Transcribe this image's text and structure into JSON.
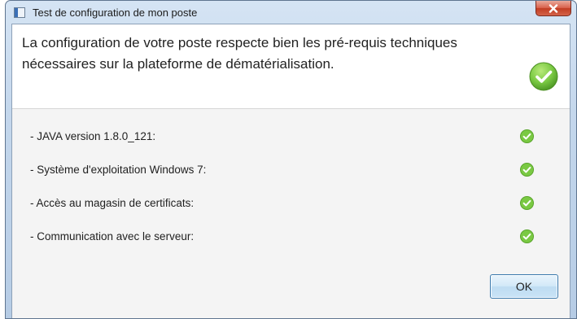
{
  "window": {
    "title": "Test de configuration de mon poste",
    "close_icon": "close-icon"
  },
  "header": {
    "message": "La configuration de votre poste respecte bien les pré-requis techniques nécessaires sur la plateforme de dématérialisation.",
    "status_icon": "check-circle-icon"
  },
  "checks": [
    {
      "label": "- JAVA version 1.8.0_121:",
      "status": "ok"
    },
    {
      "label": "- Système d'exploitation Windows 7:",
      "status": "ok"
    },
    {
      "label": "- Accès au magasin de certificats:",
      "status": "ok"
    },
    {
      "label": "- Communication avec le serveur:",
      "status": "ok"
    }
  ],
  "buttons": {
    "ok_label": "OK"
  },
  "colors": {
    "success_green": "#7ac943",
    "button_border": "#3d7bad",
    "close_red": "#c13d23"
  }
}
